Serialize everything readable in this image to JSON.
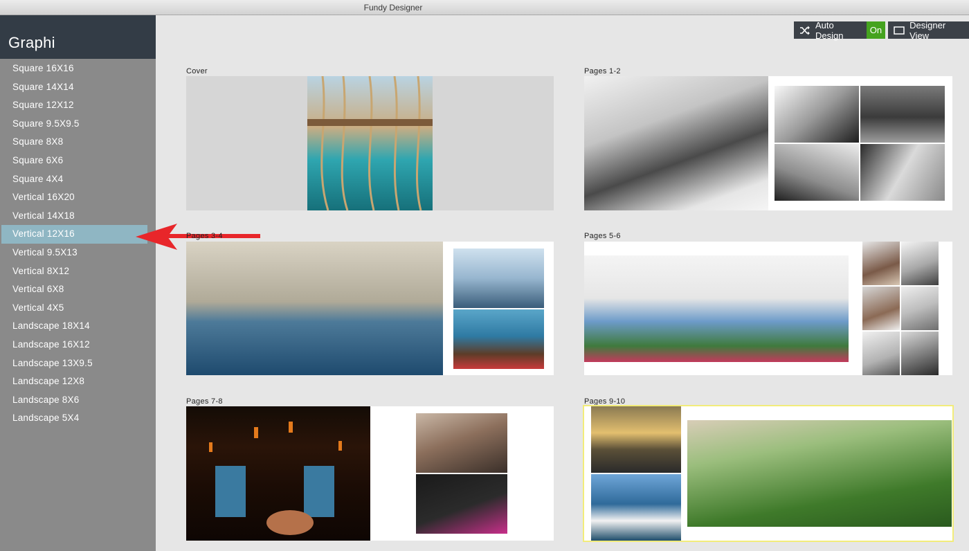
{
  "window": {
    "title": "Fundy Designer"
  },
  "sidebar": {
    "title": "Graphi",
    "items": [
      {
        "label": "Square 16X16"
      },
      {
        "label": "Square 14X14"
      },
      {
        "label": "Square 12X12"
      },
      {
        "label": "Square 9.5X9.5"
      },
      {
        "label": "Square 8X8"
      },
      {
        "label": "Square 6X6"
      },
      {
        "label": "Square 4X4"
      },
      {
        "label": "Vertical 16X20"
      },
      {
        "label": "Vertical 14X18"
      },
      {
        "label": "Vertical 12X16"
      },
      {
        "label": "Vertical 9.5X13"
      },
      {
        "label": "Vertical 8X12"
      },
      {
        "label": "Vertical 6X8"
      },
      {
        "label": "Vertical 4X5"
      },
      {
        "label": "Landscape 18X14"
      },
      {
        "label": "Landscape 16X12"
      },
      {
        "label": "Landscape 13X9.5"
      },
      {
        "label": "Landscape 12X8"
      },
      {
        "label": "Landscape 8X6"
      },
      {
        "label": "Landscape 5X4"
      }
    ],
    "selected": "Vertical 12X16"
  },
  "toolbar": {
    "auto_design_label": "Auto Design",
    "auto_design_state": "On",
    "designer_view_label": "Designer View",
    "auto_design_icon": "shuffle-icon",
    "designer_view_icon": "monitor-icon"
  },
  "spreads": [
    {
      "label": "Cover"
    },
    {
      "label": "Pages 1-2"
    },
    {
      "label": "Pages 3-4"
    },
    {
      "label": "Pages 5-6"
    },
    {
      "label": "Pages 7-8"
    },
    {
      "label": "Pages 9-10"
    }
  ],
  "colors": {
    "sidebar_header": "#333c46",
    "sidebar_bg": "#8a8a8a",
    "selected_item": "#8fb6c3",
    "on_badge": "#45a31f",
    "annotation_arrow": "#e8262a",
    "selected_spread_outline": "#f2ec7a"
  }
}
